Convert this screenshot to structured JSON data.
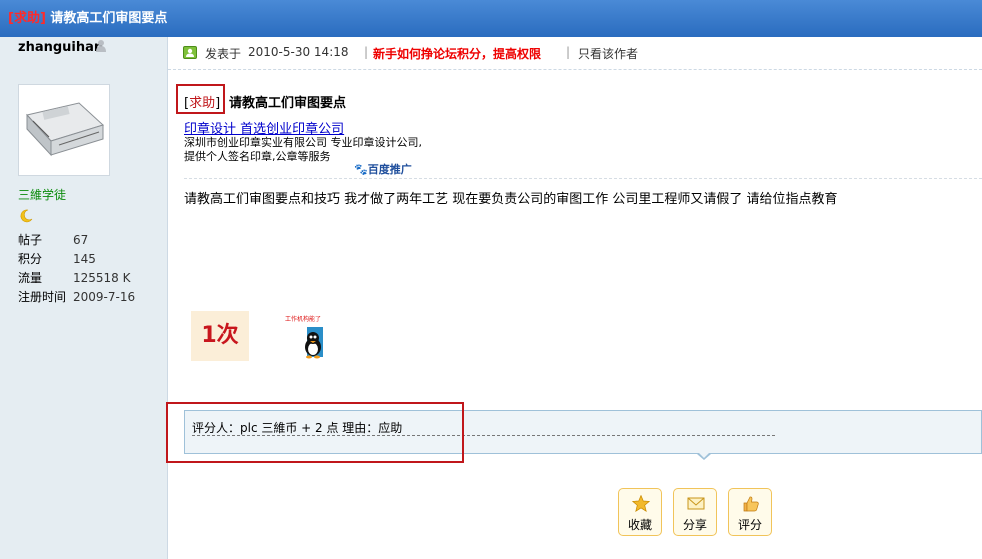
{
  "thread": {
    "tag": "[求助]",
    "title": "请教高工们审图要点"
  },
  "user": {
    "name": "zhanguihan",
    "rank": "三維学徒",
    "stats": [
      {
        "label": "帖子",
        "value": "67"
      },
      {
        "label": "积分",
        "value": "145"
      },
      {
        "label": "流量",
        "value": "125518 K"
      },
      {
        "label": "注册时间",
        "value": "2009-7-16"
      }
    ]
  },
  "meta": {
    "posted_label": "发表于",
    "posted_time": "2010-5-30 14:18",
    "separator": "|",
    "promo_link": "新手如何挣论坛积分，提高权限",
    "only_author": "只看该作者"
  },
  "post": {
    "tag_open": "[",
    "tag_text": "求助",
    "tag_close": "]",
    "title": "请教高工们审图要点",
    "ad_link": "印章设计  首选创业印章公司",
    "ad_desc": "深圳市创业印章实业有限公司 专业印章设计公司,提供个人签名印章,公章等服务",
    "ad_logo": "百度推广",
    "body": "请教高工们审图要点和技巧  我才做了两年工艺  现在要负责公司的审图工作  公司里工程师又请假了  请给位指点教育",
    "img_once_text": "1次",
    "img_cartoon_text": "工作机构能了"
  },
  "rating": {
    "text": "评分人：plc 三維币  + 2 点  理由：应助"
  },
  "actions": {
    "favorite": "收藏",
    "share": "分享",
    "rate": "评分"
  },
  "colors": {
    "title_bar": "#2a6cbf",
    "tag_red": "#c0171b",
    "sidebar_bg": "#e5edf2",
    "rank_green": "#0b8a0b",
    "rating_bg": "#eef4f8"
  }
}
